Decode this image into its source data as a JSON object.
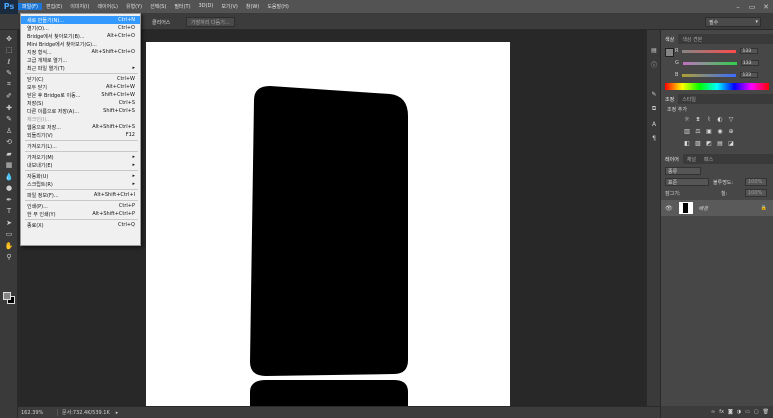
{
  "app": {
    "logo": "Ps"
  },
  "menubar": {
    "items": [
      "파일(F)",
      "편집(E)",
      "이미지(I)",
      "레이어(L)",
      "유형(Y)",
      "선택(S)",
      "필터(T)",
      "3D(D)",
      "보기(V)",
      "창(W)",
      "도움말(H)"
    ]
  },
  "window_controls": [
    "–",
    "▭",
    "✕"
  ],
  "options": {
    "clear_label": "클리어스",
    "partial_label": "가장자리 다듬기...",
    "workspace": "필수"
  },
  "file_menu": {
    "items": [
      {
        "label": "새로 만들기(N)...",
        "shortcut": "Ctrl+N",
        "highlighted": true
      },
      {
        "label": "열기(O)...",
        "shortcut": "Ctrl+O"
      },
      {
        "label": "Bridge에서 찾아보기(B)...",
        "shortcut": "Alt+Ctrl+O"
      },
      {
        "label": "Mini Bridge에서 찾아보기(G)...",
        "shortcut": ""
      },
      {
        "label": "지정 형식...",
        "shortcut": "Alt+Shift+Ctrl+O"
      },
      {
        "label": "고급 개체로 열기...",
        "shortcut": ""
      },
      {
        "label": "최근 파일 열기(T)",
        "shortcut": "▸"
      },
      {
        "sep": true
      },
      {
        "label": "닫기(C)",
        "shortcut": "Ctrl+W"
      },
      {
        "label": "모두 닫기",
        "shortcut": "Alt+Ctrl+W"
      },
      {
        "label": "닫은 후 Bridge로 이동...",
        "shortcut": "Shift+Ctrl+W"
      },
      {
        "label": "저장(S)",
        "shortcut": "Ctrl+S"
      },
      {
        "label": "다른 이름으로 저장(A)...",
        "shortcut": "Shift+Ctrl+S"
      },
      {
        "label": "체크인(I)...",
        "shortcut": "",
        "disabled": true
      },
      {
        "label": "웹용으로 저장...",
        "shortcut": "Alt+Shift+Ctrl+S"
      },
      {
        "label": "되돌리기(V)",
        "shortcut": "F12"
      },
      {
        "sep": true
      },
      {
        "label": "가져오기(L)...",
        "shortcut": ""
      },
      {
        "sep": true
      },
      {
        "label": "가져오기(M)",
        "shortcut": "▸"
      },
      {
        "label": "내보내기(E)",
        "shortcut": "▸"
      },
      {
        "sep": true
      },
      {
        "label": "자동화(U)",
        "shortcut": "▸"
      },
      {
        "label": "스크립트(R)",
        "shortcut": "▸"
      },
      {
        "sep": true
      },
      {
        "label": "파일 정보(F)...",
        "shortcut": "Alt+Shift+Ctrl+I"
      },
      {
        "sep": true
      },
      {
        "label": "인쇄(P)...",
        "shortcut": "Ctrl+P"
      },
      {
        "label": "한 부 인쇄(Y)",
        "shortcut": "Alt+Shift+Ctrl+P"
      },
      {
        "sep": true
      },
      {
        "label": "종료(X)",
        "shortcut": "Ctrl+Q"
      }
    ]
  },
  "status": {
    "zoom": "162.39%",
    "doc": "문서:732.4K/539.1K"
  },
  "color_panel": {
    "tabs": [
      "색상",
      "색상 견본"
    ],
    "channels": [
      {
        "label": "R",
        "value": "133",
        "gradient": "#ff4a4a"
      },
      {
        "label": "G",
        "value": "133",
        "gradient": "#2fd04a"
      },
      {
        "label": "B",
        "value": "133",
        "gradient": "#3a6cff"
      }
    ]
  },
  "adjust_panel": {
    "tabs": [
      "조정",
      "스타일"
    ],
    "title": "조정 추가"
  },
  "layers_panel": {
    "tabs": [
      "레이어",
      "채널",
      "패스"
    ],
    "kind_label": "종류",
    "mode_label": "표준",
    "opacity_label": "불투명도:",
    "opacity_value": "100%",
    "lock_label": "잠그기:",
    "fill_label": "칠:",
    "fill_value": "100%",
    "layer_name": "배경"
  },
  "toolbar_icons": [
    "move-icon",
    "marquee-icon",
    "lasso-icon",
    "quick-select-icon",
    "crop-icon",
    "eyedropper-icon",
    "healing-icon",
    "brush-icon",
    "stamp-icon",
    "history-brush-icon",
    "eraser-icon",
    "gradient-icon",
    "blur-icon",
    "dodge-icon",
    "pen-icon",
    "type-icon",
    "path-select-icon",
    "shape-icon",
    "hand-icon",
    "zoom-icon"
  ],
  "toolbar_glyphs": [
    "✥",
    "⬚",
    "ℓ",
    "✎",
    "⌗",
    "✐",
    "✚",
    "✎",
    "♙",
    "⟲",
    "▰",
    "▦",
    "💧",
    "●",
    "✒",
    "T",
    "➤",
    "▭",
    "✋",
    "⚲"
  ],
  "colors": {
    "accent": "#3399ff",
    "panel": "#474747",
    "canvas_bg": "#282828"
  }
}
